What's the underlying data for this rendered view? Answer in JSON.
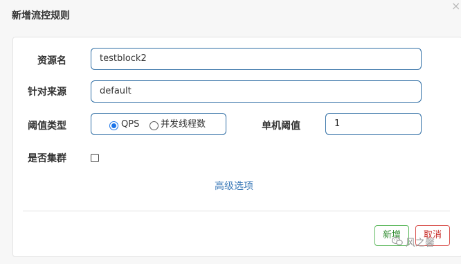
{
  "dialog": {
    "title": "新增流控规则",
    "close_symbol": "×"
  },
  "form": {
    "resource_name": {
      "label": "资源名",
      "value": "testblock2"
    },
    "limit_app": {
      "label": "针对来源",
      "value": "default"
    },
    "threshold_type": {
      "label": "阈值类型",
      "options": [
        {
          "label": "QPS",
          "checked": true
        },
        {
          "label": "并发线程数",
          "checked": false
        }
      ]
    },
    "single_threshold": {
      "label": "单机阈值",
      "value": "1"
    },
    "cluster_mode": {
      "label": "是否集群",
      "checked": false
    },
    "advanced_link": "高级选项"
  },
  "footer": {
    "add_label": "新增",
    "cancel_label": "取消"
  },
  "watermark": {
    "icon": "wechat-icon",
    "text": "风之馨"
  },
  "colors": {
    "input_border": "#2e6da4",
    "link": "#3c7ab8",
    "add_border": "#5cb85c",
    "cancel_border": "#d9534f"
  }
}
